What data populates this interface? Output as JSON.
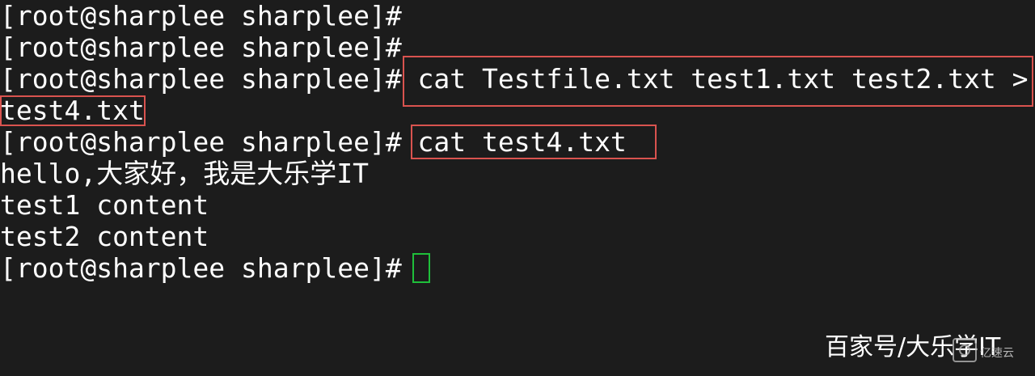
{
  "terminal": {
    "lines": [
      "[root@sharplee sharplee]#",
      "[root@sharplee sharplee]#",
      "[root@sharplee sharplee]# cat Testfile.txt test1.txt test2.txt >",
      "test4.txt",
      "[root@sharplee sharplee]# cat test4.txt",
      "hello,大家好，我是大乐学IT",
      "test1 content",
      "test2 content",
      "[root@sharplee sharplee]# "
    ]
  },
  "watermark": {
    "text": "百家号/大乐学IT",
    "small_text": "亿速云"
  },
  "colors": {
    "background": "#1c1c1c",
    "text": "#ffffff",
    "highlight_box": "#d9534f",
    "cursor": "#1fbf3a"
  }
}
